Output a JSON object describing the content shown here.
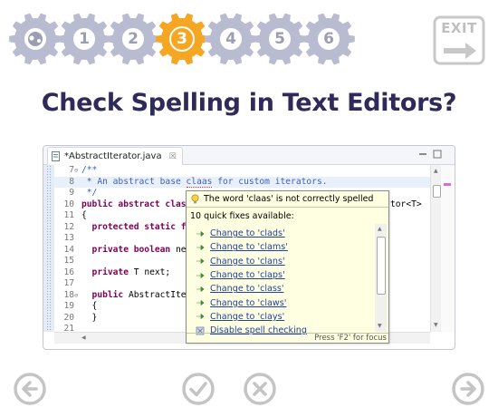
{
  "steps": [
    {
      "label": "",
      "state": "done"
    },
    {
      "label": "1",
      "state": "pending"
    },
    {
      "label": "2",
      "state": "pending"
    },
    {
      "label": "3",
      "state": "active"
    },
    {
      "label": "4",
      "state": "pending"
    },
    {
      "label": "5",
      "state": "pending"
    },
    {
      "label": "6",
      "state": "pending"
    }
  ],
  "exit_label": "EXIT",
  "title": "Check Spelling in Text Editors?",
  "editor": {
    "tab_title": "*AbstractIterator.java",
    "tab_close": "☒",
    "lines": [
      {
        "num": "7",
        "fold": "⊖",
        "text": "/**"
      },
      {
        "num": "8",
        "fold": "",
        "text": " * An abstract base claas for custom iterators."
      },
      {
        "num": "9",
        "fold": "",
        "text": " */"
      },
      {
        "num": "10",
        "fold": "",
        "text": "public abstract class AbstractIterator<T>"
      },
      {
        "num": "11",
        "fold": "",
        "text": "{"
      },
      {
        "num": "12",
        "fold": "",
        "text": "  protected static final Object NO_MORE_ELEMENTS;"
      },
      {
        "num": "13",
        "fold": "",
        "text": ""
      },
      {
        "num": "14",
        "fold": "",
        "text": "  private boolean next;"
      },
      {
        "num": "15",
        "fold": "",
        "text": ""
      },
      {
        "num": "16",
        "fold": "",
        "text": "  private T next;"
      },
      {
        "num": "17",
        "fold": "",
        "text": ""
      },
      {
        "num": "18",
        "fold": "⊖",
        "text": "  public AbstractIterator()"
      },
      {
        "num": "19",
        "fold": "",
        "text": "  {"
      },
      {
        "num": "20",
        "fold": "",
        "text": "  }"
      },
      {
        "num": "21",
        "fold": "",
        "text": ""
      }
    ],
    "visible_line7": "/**",
    "line8_prefix": " * An abstract base ",
    "line8_word": "claas",
    "line8_suffix": " for custom iterators.",
    "line9": " */",
    "line10_kw": "public abstract ",
    "line10_rest": "clas",
    "line10_tail": "tor<T>",
    "line11": "{",
    "line12_kw": "  protected static f",
    "line12_tail": ";",
    "line14_kw": "  private boolean ",
    "line14_rest": "ne",
    "line16_kw": "  private ",
    "line16_rest": "T next;",
    "line18_kw": "  public ",
    "line18_rest": "AbstractIte",
    "line19": "  {",
    "line20": "  }"
  },
  "popup": {
    "header": "The word 'claas' is not correctly spelled",
    "subheader": "10 quick fixes available:",
    "fixes": [
      "Change to 'clads'",
      "Change to 'clams'",
      "Change to 'clans'",
      "Change to 'claps'",
      "Change to 'class'",
      "Change to 'claws'",
      "Change to 'clays'",
      "Disable spell checking"
    ],
    "footer": "Press 'F2' for focus"
  },
  "nav": {
    "back": "arrow-left-icon",
    "yes": "check-icon",
    "no": "x-icon",
    "next": "arrow-right-icon"
  },
  "colors": {
    "gear_pending": "#b9bcd0",
    "gear_active": "#f5a623",
    "title": "#2e2b5a",
    "link": "#1e3fa8",
    "tooltip_bg": "#ffffe1"
  }
}
